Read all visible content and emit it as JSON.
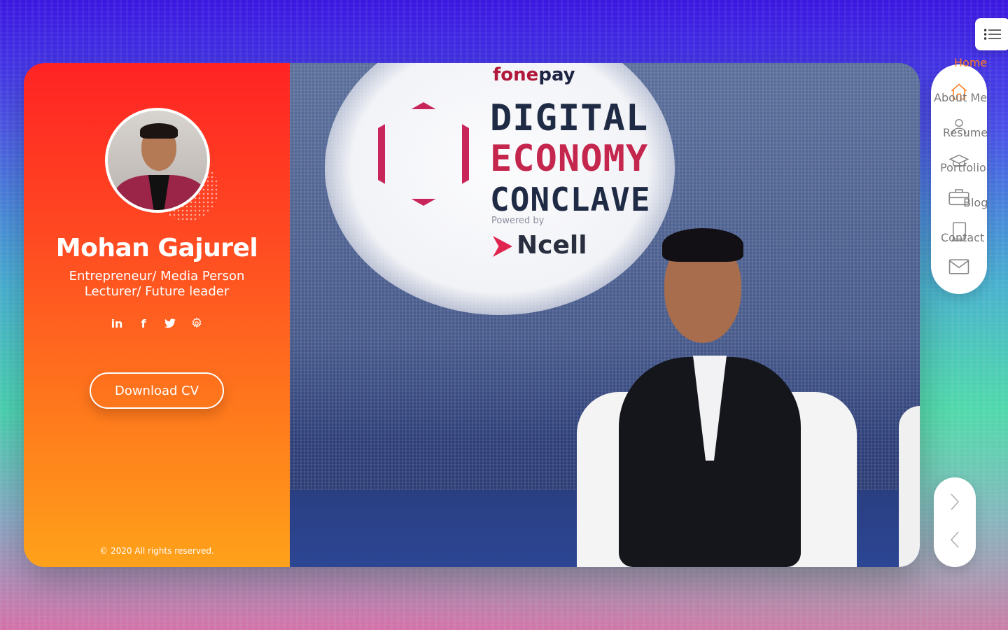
{
  "profile": {
    "name": "Mohan Gajurel",
    "subtitle_line1": "Entrepreneur/ Media Person",
    "subtitle_line2": "Lecturer/ Future leader",
    "socials": [
      {
        "icon": "linkedin-icon",
        "glyph": "in"
      },
      {
        "icon": "facebook-icon",
        "glyph": "f"
      },
      {
        "icon": "twitter-icon",
        "glyph": "t"
      },
      {
        "icon": "settings-icon",
        "glyph": "⚙"
      }
    ],
    "cv_button": "Download CV",
    "footer": "© 2020 All rights reserved."
  },
  "hero": {
    "logo_fone": "fone",
    "logo_pay": "pay",
    "title_line1": "DIGITAL",
    "title_line2": "ECONOMY",
    "title_line3": "CONCLAVE",
    "powered_by": "Powered by",
    "sponsor": "Ncell"
  },
  "nav": {
    "items": [
      {
        "label": "Home",
        "icon": "home-icon",
        "active": true
      },
      {
        "label": "About Me",
        "icon": "user-icon",
        "active": false
      },
      {
        "label": "Resume",
        "icon": "graduation-cap-icon",
        "active": false
      },
      {
        "label": "Portfolio",
        "icon": "briefcase-icon",
        "active": false
      },
      {
        "label": "Blog",
        "icon": "book-icon",
        "active": false
      },
      {
        "label": "Contact",
        "icon": "envelope-icon",
        "active": false
      }
    ]
  },
  "colors": {
    "accent": "#ff7a1c",
    "gradient_top": "#ff2323",
    "gradient_bottom": "#ffa21a"
  }
}
